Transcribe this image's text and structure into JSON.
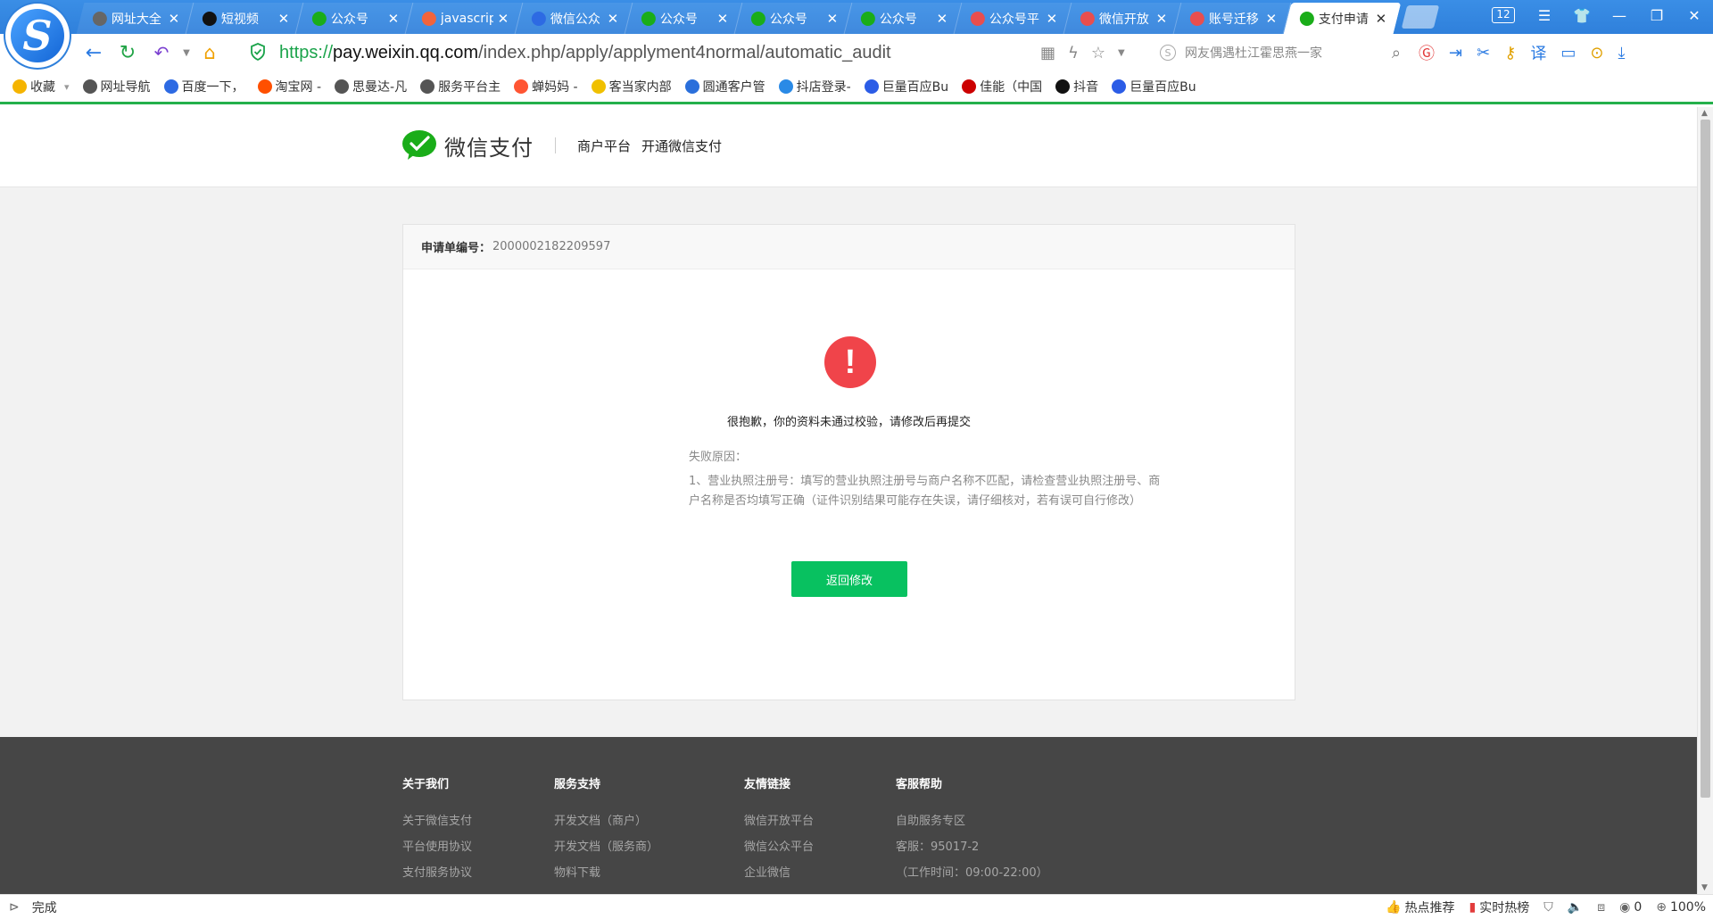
{
  "browser": {
    "tab_count": "12",
    "tabs": [
      {
        "title": "网址大全",
        "icon": "globe-icon",
        "color": "#666666"
      },
      {
        "title": "短视频",
        "icon": "tiktok-icon",
        "color": "#111111"
      },
      {
        "title": "公众号",
        "icon": "wechat-mp-icon",
        "color": "#1aad19"
      },
      {
        "title": "javascript",
        "icon": "sogou-icon",
        "color": "#f2643c"
      },
      {
        "title": "微信公众",
        "icon": "baidu-paw-icon",
        "color": "#2d6ae3"
      },
      {
        "title": "公众号",
        "icon": "wechat-mp-icon",
        "color": "#1aad19"
      },
      {
        "title": "公众号",
        "icon": "wechat-mp-icon",
        "color": "#1aad19"
      },
      {
        "title": "公众号",
        "icon": "wechat-mp-icon",
        "color": "#1aad19"
      },
      {
        "title": "公众号平",
        "icon": "grid-icon",
        "color": "#e94e4e"
      },
      {
        "title": "微信开放",
        "icon": "grid-icon",
        "color": "#e94e4e"
      },
      {
        "title": "账号迁移",
        "icon": "grid-icon",
        "color": "#e94e4e"
      },
      {
        "title": "支付申请",
        "icon": "wechat-pay-icon",
        "color": "#1aad19"
      }
    ],
    "url": {
      "scheme": "https://",
      "host": "pay.weixin.qq.com",
      "path": "/index.php/apply/applyment4normal/automatic_audit"
    },
    "search_placeholder": "网友偶遇杜江霍思燕一家",
    "bookmarks": [
      {
        "label": "收藏",
        "icon": "star-icon",
        "color": "#f5b400"
      },
      {
        "label": "网址导航",
        "icon": "globe-icon",
        "color": "#555555"
      },
      {
        "label": "百度一下，",
        "icon": "baidu-paw-icon",
        "color": "#2d6ae3"
      },
      {
        "label": "淘宝网 -",
        "icon": "taobao-icon",
        "color": "#ff5000"
      },
      {
        "label": "思曼达-凡",
        "icon": "person-icon",
        "color": "#555555"
      },
      {
        "label": "服务平台主",
        "icon": "doc-icon",
        "color": "#555555"
      },
      {
        "label": "蝉妈妈 -",
        "icon": "chanmama-icon",
        "color": "#ff5533"
      },
      {
        "label": "客当家内部",
        "icon": "kedangjia-icon",
        "color": "#f0c000"
      },
      {
        "label": "圆通客户管",
        "icon": "k-icon",
        "color": "#2a6fdb"
      },
      {
        "label": "抖店登录-",
        "icon": "doudian-icon",
        "color": "#2a8ae6"
      },
      {
        "label": "巨量百应Bu",
        "icon": "b-icon",
        "color": "#2b5ce6"
      },
      {
        "label": "佳能（中国",
        "icon": "canon-icon",
        "color": "#cc0000"
      },
      {
        "label": "抖音",
        "icon": "tiktok-icon",
        "color": "#111111"
      },
      {
        "label": "巨量百应Bu",
        "icon": "b-icon",
        "color": "#2b5ce6"
      }
    ],
    "status_text": "完成",
    "status_right": {
      "hot": "热点推荐",
      "realtime": "实时热榜",
      "download_count": "0",
      "zoom": "100%"
    }
  },
  "header": {
    "brand_name": "微信支付",
    "sub_items": [
      "商户平台",
      "开通微信支付"
    ]
  },
  "card": {
    "order_label": "申请单编号：",
    "order_number": "2000002182209597",
    "error_title": "很抱歉，你的资料未通过校验，请修改后再提交",
    "reason_label": "失败原因：",
    "reason_text": "1、营业执照注册号：填写的营业执照注册号与商户名称不匹配，请检查营业执照注册号、商户名称是否均填写正确（证件识别结果可能存在失误，请仔细核对，若有误可自行修改）",
    "back_button": "返回修改"
  },
  "footer": {
    "columns": [
      {
        "heading": "关于我们",
        "items": [
          "关于微信支付",
          "平台使用协议",
          "支付服务协议"
        ]
      },
      {
        "heading": "服务支持",
        "items": [
          "开发文档（商户）",
          "开发文档（服务商）",
          "物料下载"
        ]
      },
      {
        "heading": "友情链接",
        "items": [
          "微信开放平台",
          "微信公众平台",
          "企业微信"
        ]
      },
      {
        "heading": "客服帮助",
        "items": [
          "自助服务专区",
          "客服：95017-2",
          "（工作时间：09:00-22:00）"
        ]
      }
    ]
  },
  "colors": {
    "accent_green": "#08c160",
    "error_red": "#f0444a",
    "footer_bg": "#464646"
  }
}
